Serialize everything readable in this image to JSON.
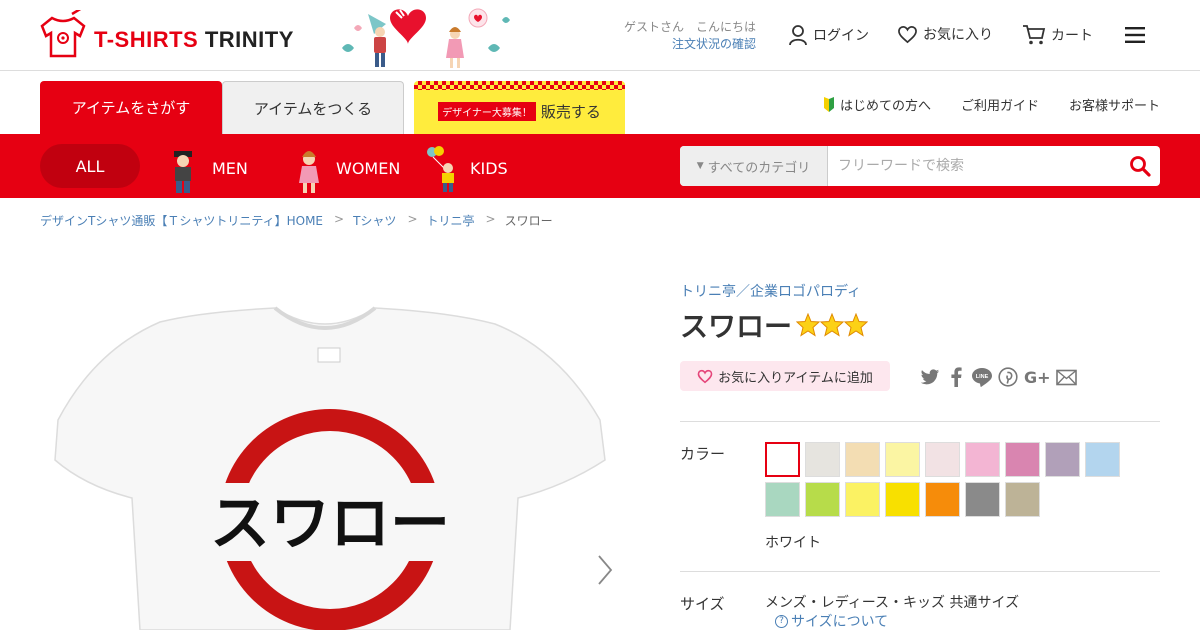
{
  "header": {
    "logo_text_red": "T-SHIRTS",
    "logo_text_dark": "TRINITY",
    "greeting_guest": "ゲストさん　こんにちは",
    "order_status_link": "注文状況の確認",
    "login_label": "ログイン",
    "favorites_label": "お気に入り",
    "cart_label": "カート"
  },
  "tabs": {
    "find_label": "アイテムをさがす",
    "make_label": "アイテムをつくる",
    "sell_badge": "デザイナー大募集！",
    "sell_label": "販売する"
  },
  "top_links": {
    "beginners": "はじめての方へ",
    "guide": "ご利用ガイド",
    "support": "お客様サポート"
  },
  "categories": {
    "all": "ALL",
    "men": "MEN",
    "women": "WOMEN",
    "kids": "KIDS"
  },
  "search": {
    "category_select": "すべてのカテゴリ",
    "placeholder": "フリーワードで検索"
  },
  "breadcrumb": [
    "デザインTシャツ通販【Ｔシャツトリニティ】HOME",
    "Tシャツ",
    "トリニ亭",
    "スワロー"
  ],
  "product": {
    "shop_link": "トリニ亭",
    "separator": "／",
    "category_link": "企業ロゴパロディ",
    "title": "スワロー",
    "star_rating": 3,
    "print_text": "スワロー",
    "favorite_button": "お気に入りアイテムに追加",
    "color_label": "カラー",
    "color_swatches": [
      "#ffffff",
      "#e6e4df",
      "#f3ddb3",
      "#fbf5a3",
      "#f2e2e4",
      "#f3b5d3",
      "#d985b0",
      "#b1a0b9",
      "#b3d5ee",
      "#a9d7c0",
      "#b7dc4a",
      "#fbf263",
      "#f8e000",
      "#f68c0a",
      "#8a8a8a",
      "#bdb397"
    ],
    "selected_color": "ホワイト",
    "size_label": "サイズ",
    "size_value": "メンズ・レディース・キッズ 共通サイズ",
    "size_link": "サイズについて",
    "share_icons": [
      "twitter-icon",
      "facebook-icon",
      "line-icon",
      "pinterest-icon",
      "google-plus-icon",
      "mail-icon"
    ]
  },
  "colors": {
    "brand_red": "#e60012",
    "link_blue": "#4a7fb5",
    "sell_yellow": "#ffec3d"
  }
}
